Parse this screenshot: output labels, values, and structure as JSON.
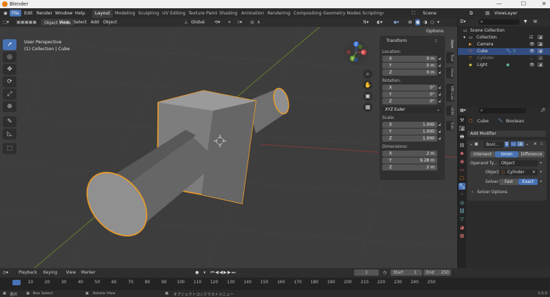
{
  "window": {
    "title": "Blender",
    "minimize": "—",
    "maximize": "☐",
    "close": "✕"
  },
  "menus": [
    "File",
    "Edit",
    "Render",
    "Window",
    "Help"
  ],
  "workspaces": [
    "Layout",
    "Modeling",
    "Sculpting",
    "UV Editing",
    "Texture Paint",
    "Shading",
    "Animation",
    "Rendering",
    "Compositing",
    "Geometry Nodes",
    "Scripting"
  ],
  "scene_name": "Scene",
  "view_layer": "ViewLayer",
  "viewport_header": {
    "mode": "Object Mode",
    "menus": [
      "View",
      "Select",
      "Add",
      "Object"
    ],
    "transform_orientation": "Global",
    "options": "Options"
  },
  "viewport": {
    "title": "User Perspective",
    "subtitle": "(1) Collection | Cube",
    "gizmo": {
      "x": "X",
      "y": "Y",
      "z": "Z"
    }
  },
  "npanel": {
    "header": "Transform",
    "location_label": "Location:",
    "location": [
      {
        "k": "X",
        "v": "0 m"
      },
      {
        "k": "Y",
        "v": "0 m"
      },
      {
        "k": "Z",
        "v": "0 m"
      }
    ],
    "rotation_label": "Rotation:",
    "rotation": [
      {
        "k": "X",
        "v": "0°"
      },
      {
        "k": "Y",
        "v": "0°"
      },
      {
        "k": "Z",
        "v": "0°"
      }
    ],
    "rotation_mode": "XYZ Euler",
    "scale_label": "Scale:",
    "scale": [
      {
        "k": "X",
        "v": "1.000"
      },
      {
        "k": "Y",
        "v": "1.000"
      },
      {
        "k": "Z",
        "v": "1.000"
      }
    ],
    "dimensions_label": "Dimensions:",
    "dimensions": [
      {
        "k": "X",
        "v": "2 m"
      },
      {
        "k": "Y",
        "v": "9.28 m"
      },
      {
        "k": "Z",
        "v": "2 m"
      }
    ],
    "tabs": [
      "Item",
      "Tool",
      "View",
      "MB-Lab",
      "VRM",
      "Edit"
    ]
  },
  "outliner": {
    "root": "Scene Collection",
    "collection": "Collection",
    "items": [
      {
        "name": "Camera",
        "color": "#d28a3c"
      },
      {
        "name": "Cube",
        "color": "#e07a2f"
      },
      {
        "name": "Cylinder",
        "color": "#e07a2f"
      },
      {
        "name": "Light",
        "color": "#d8c84a"
      }
    ]
  },
  "properties": {
    "object_name": "Cube",
    "modifier_ref": "Boolean",
    "add_modifier": "Add Modifier",
    "modifier_name": "Bool...",
    "operations": [
      "Intersect",
      "Union",
      "Difference"
    ],
    "operand_type_label": "Operand Ty...",
    "operand_type": "Object",
    "object_label": "Object",
    "object_value": "Cylinder",
    "solver_label": "Solver",
    "solver_options": [
      "Fast",
      "Exact"
    ],
    "solver_options_label": "Solver Options"
  },
  "timeline": {
    "menus": [
      "Playback",
      "Keying",
      "View",
      "Marker"
    ],
    "current_frame": "1",
    "start_label": "Start",
    "start": "1",
    "end_label": "End",
    "end": "250",
    "ruler": [
      "1",
      "10",
      "20",
      "30",
      "40",
      "50",
      "60",
      "70",
      "80",
      "90",
      "100",
      "110",
      "120",
      "130",
      "140",
      "150",
      "160",
      "170",
      "180",
      "190",
      "200",
      "210",
      "220",
      "230",
      "240",
      "250"
    ]
  },
  "statusbar": {
    "select": "選択",
    "box_select": "Box Select",
    "rotate_view": "Rotate View",
    "context_menu": "オブジェクトコンテクストメニュー",
    "version": "3.0.0"
  },
  "colors": {
    "accent": "#4772b3",
    "selection_outline": "#f0a030",
    "grid_x": "#8a3a3a",
    "grid_y": "#6a8a2a"
  }
}
